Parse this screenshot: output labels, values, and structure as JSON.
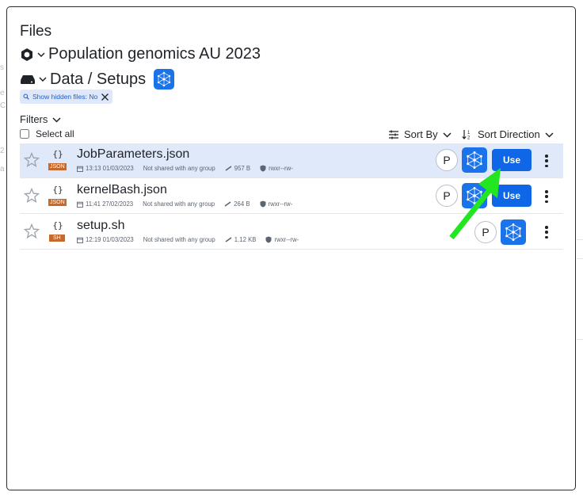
{
  "modal": {
    "title": "Files",
    "project": "Population genomics AU 2023",
    "path": "Data / Setups",
    "hidden_chip": "Show hidden files: No",
    "filters_label": "Filters",
    "select_all_label": "Select all",
    "sort_by_label": "Sort By",
    "sort_direction_label": "Sort Direction"
  },
  "files": [
    {
      "name": "JobParameters.json",
      "ext": "JSON",
      "ext_color": "#c8682a",
      "modified": "13:13 01/03/2023",
      "sharing": "Not shared with any group",
      "size": "957 B",
      "permissions": "rwxr--rw-",
      "provider": "P",
      "action": "Use",
      "selected": true
    },
    {
      "name": "kernelBash.json",
      "ext": "JSON",
      "ext_color": "#c8682a",
      "modified": "11:41 27/02/2023",
      "sharing": "Not shared with any group",
      "size": "264 B",
      "permissions": "rwxr--rw-",
      "provider": "P",
      "action": "Use",
      "selected": false
    },
    {
      "name": "setup.sh",
      "ext": "SH",
      "ext_color": "#c8682a",
      "modified": "12:19 01/03/2023",
      "sharing": "Not shared with any group",
      "size": "1.12 KB",
      "permissions": "rwxr--rw-",
      "provider": "P",
      "action": "",
      "selected": false
    }
  ],
  "colors": {
    "accent": "#1a73e8",
    "chip_bg": "#dfe8fb",
    "selected_row": "#dfe9fa",
    "annotation_arrow": "#22e622"
  },
  "icons": [
    "project-hexagon-icon",
    "drive-icon",
    "chevron-down-icon",
    "app-network-icon",
    "search-icon",
    "close-icon",
    "sort-by-icon",
    "sort-direction-icon",
    "star-icon",
    "calendar-icon",
    "size-icon",
    "shield-icon",
    "kebab-menu-icon"
  ]
}
